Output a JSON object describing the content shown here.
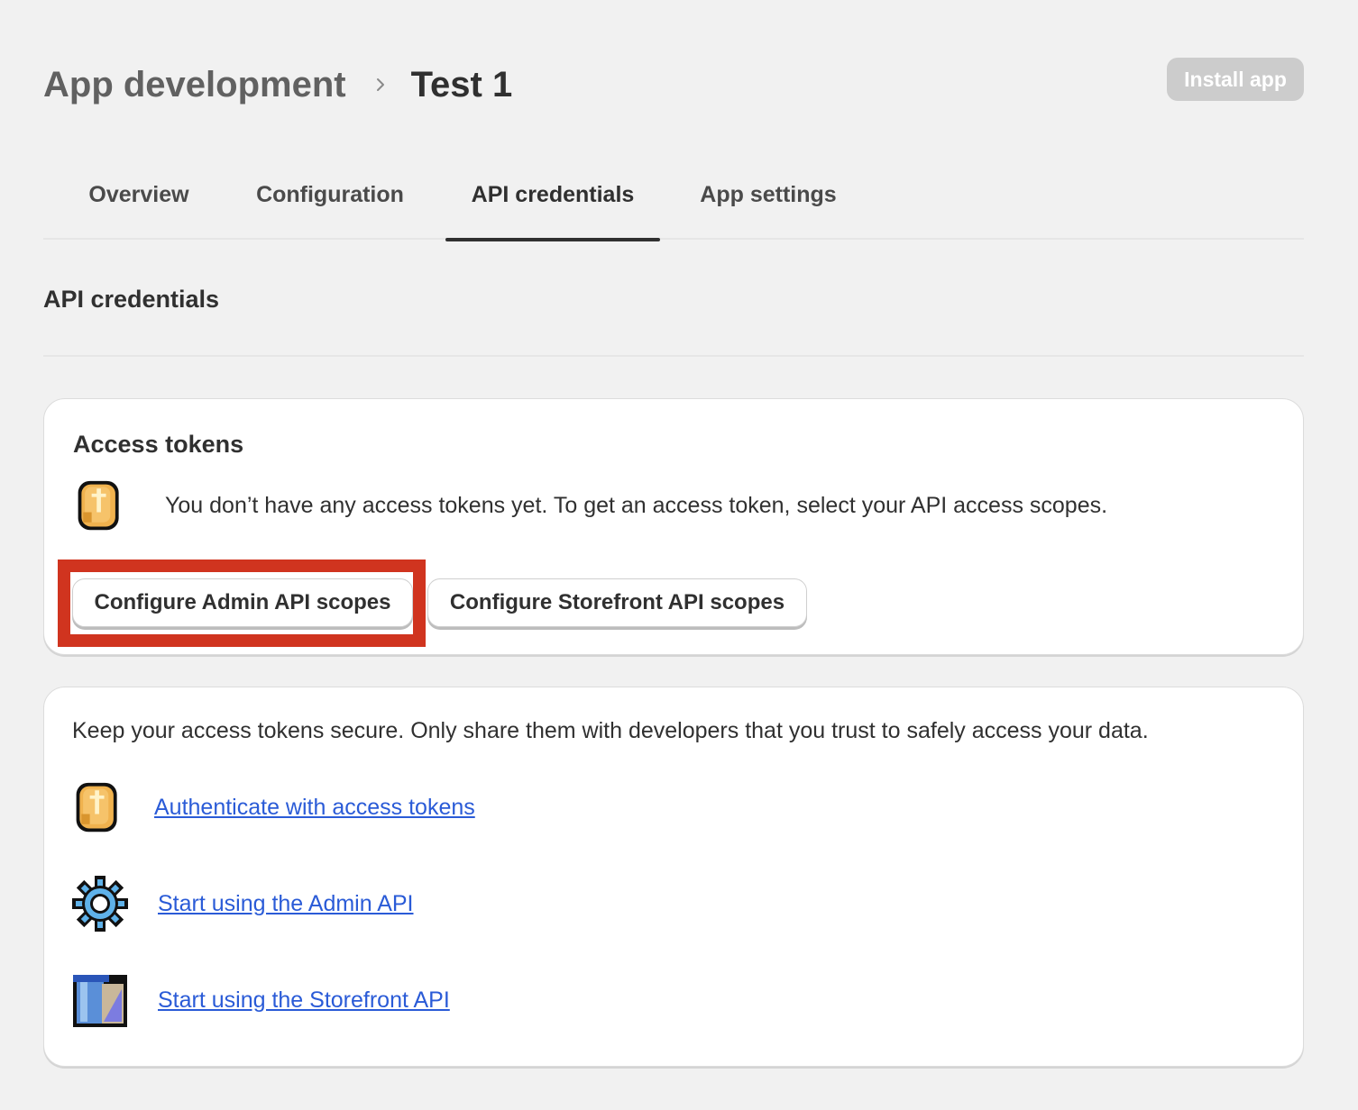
{
  "header": {
    "breadcrumb_parent": "App development",
    "page_title": "Test 1",
    "install_button": "Install app"
  },
  "tabs": [
    {
      "label": "Overview",
      "active": false
    },
    {
      "label": "Configuration",
      "active": false
    },
    {
      "label": "API credentials",
      "active": true
    },
    {
      "label": "App settings",
      "active": false
    }
  ],
  "section_title": "API credentials",
  "access_tokens_card": {
    "title": "Access tokens",
    "icon": "coin-icon",
    "description": "You don’t have any access tokens yet. To get an access token, select your API access scopes.",
    "admin_button": "Configure Admin API scopes",
    "storefront_button": "Configure Storefront API scopes"
  },
  "resources_card": {
    "intro": "Keep your access tokens secure. Only share them with developers that you trust to safely access your data.",
    "links": [
      {
        "label": "Authenticate with access tokens",
        "icon": "coin-icon"
      },
      {
        "label": "Start using the Admin API",
        "icon": "gear-icon"
      },
      {
        "label": "Start using the Storefront API",
        "icon": "storefront-icon"
      }
    ]
  },
  "colors": {
    "background": "#f1f1f1",
    "link": "#2a5bd7",
    "highlight": "#d0341f",
    "install_button_bg": "#cccccc"
  }
}
